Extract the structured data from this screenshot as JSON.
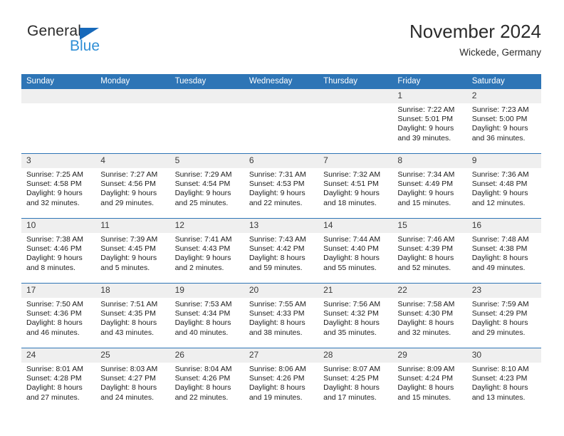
{
  "brand": {
    "name_part1": "General",
    "name_part2": "Blue",
    "triangle_color": "#1769ba",
    "blue_color": "#2f8fd6"
  },
  "header": {
    "month_title": "November 2024",
    "location": "Wickede, Germany"
  },
  "theme": {
    "header_blue": "#2e75b6",
    "daynum_gray": "#efefef",
    "row_divider": "#2e75b6"
  },
  "weekdays": [
    "Sunday",
    "Monday",
    "Tuesday",
    "Wednesday",
    "Thursday",
    "Friday",
    "Saturday"
  ],
  "weeks": [
    [
      {
        "day": "",
        "sunrise": "",
        "sunset": "",
        "daylight1": "",
        "daylight2": ""
      },
      {
        "day": "",
        "sunrise": "",
        "sunset": "",
        "daylight1": "",
        "daylight2": ""
      },
      {
        "day": "",
        "sunrise": "",
        "sunset": "",
        "daylight1": "",
        "daylight2": ""
      },
      {
        "day": "",
        "sunrise": "",
        "sunset": "",
        "daylight1": "",
        "daylight2": ""
      },
      {
        "day": "",
        "sunrise": "",
        "sunset": "",
        "daylight1": "",
        "daylight2": ""
      },
      {
        "day": "1",
        "sunrise": "Sunrise: 7:22 AM",
        "sunset": "Sunset: 5:01 PM",
        "daylight1": "Daylight: 9 hours",
        "daylight2": "and 39 minutes."
      },
      {
        "day": "2",
        "sunrise": "Sunrise: 7:23 AM",
        "sunset": "Sunset: 5:00 PM",
        "daylight1": "Daylight: 9 hours",
        "daylight2": "and 36 minutes."
      }
    ],
    [
      {
        "day": "3",
        "sunrise": "Sunrise: 7:25 AM",
        "sunset": "Sunset: 4:58 PM",
        "daylight1": "Daylight: 9 hours",
        "daylight2": "and 32 minutes."
      },
      {
        "day": "4",
        "sunrise": "Sunrise: 7:27 AM",
        "sunset": "Sunset: 4:56 PM",
        "daylight1": "Daylight: 9 hours",
        "daylight2": "and 29 minutes."
      },
      {
        "day": "5",
        "sunrise": "Sunrise: 7:29 AM",
        "sunset": "Sunset: 4:54 PM",
        "daylight1": "Daylight: 9 hours",
        "daylight2": "and 25 minutes."
      },
      {
        "day": "6",
        "sunrise": "Sunrise: 7:31 AM",
        "sunset": "Sunset: 4:53 PM",
        "daylight1": "Daylight: 9 hours",
        "daylight2": "and 22 minutes."
      },
      {
        "day": "7",
        "sunrise": "Sunrise: 7:32 AM",
        "sunset": "Sunset: 4:51 PM",
        "daylight1": "Daylight: 9 hours",
        "daylight2": "and 18 minutes."
      },
      {
        "day": "8",
        "sunrise": "Sunrise: 7:34 AM",
        "sunset": "Sunset: 4:49 PM",
        "daylight1": "Daylight: 9 hours",
        "daylight2": "and 15 minutes."
      },
      {
        "day": "9",
        "sunrise": "Sunrise: 7:36 AM",
        "sunset": "Sunset: 4:48 PM",
        "daylight1": "Daylight: 9 hours",
        "daylight2": "and 12 minutes."
      }
    ],
    [
      {
        "day": "10",
        "sunrise": "Sunrise: 7:38 AM",
        "sunset": "Sunset: 4:46 PM",
        "daylight1": "Daylight: 9 hours",
        "daylight2": "and 8 minutes."
      },
      {
        "day": "11",
        "sunrise": "Sunrise: 7:39 AM",
        "sunset": "Sunset: 4:45 PM",
        "daylight1": "Daylight: 9 hours",
        "daylight2": "and 5 minutes."
      },
      {
        "day": "12",
        "sunrise": "Sunrise: 7:41 AM",
        "sunset": "Sunset: 4:43 PM",
        "daylight1": "Daylight: 9 hours",
        "daylight2": "and 2 minutes."
      },
      {
        "day": "13",
        "sunrise": "Sunrise: 7:43 AM",
        "sunset": "Sunset: 4:42 PM",
        "daylight1": "Daylight: 8 hours",
        "daylight2": "and 59 minutes."
      },
      {
        "day": "14",
        "sunrise": "Sunrise: 7:44 AM",
        "sunset": "Sunset: 4:40 PM",
        "daylight1": "Daylight: 8 hours",
        "daylight2": "and 55 minutes."
      },
      {
        "day": "15",
        "sunrise": "Sunrise: 7:46 AM",
        "sunset": "Sunset: 4:39 PM",
        "daylight1": "Daylight: 8 hours",
        "daylight2": "and 52 minutes."
      },
      {
        "day": "16",
        "sunrise": "Sunrise: 7:48 AM",
        "sunset": "Sunset: 4:38 PM",
        "daylight1": "Daylight: 8 hours",
        "daylight2": "and 49 minutes."
      }
    ],
    [
      {
        "day": "17",
        "sunrise": "Sunrise: 7:50 AM",
        "sunset": "Sunset: 4:36 PM",
        "daylight1": "Daylight: 8 hours",
        "daylight2": "and 46 minutes."
      },
      {
        "day": "18",
        "sunrise": "Sunrise: 7:51 AM",
        "sunset": "Sunset: 4:35 PM",
        "daylight1": "Daylight: 8 hours",
        "daylight2": "and 43 minutes."
      },
      {
        "day": "19",
        "sunrise": "Sunrise: 7:53 AM",
        "sunset": "Sunset: 4:34 PM",
        "daylight1": "Daylight: 8 hours",
        "daylight2": "and 40 minutes."
      },
      {
        "day": "20",
        "sunrise": "Sunrise: 7:55 AM",
        "sunset": "Sunset: 4:33 PM",
        "daylight1": "Daylight: 8 hours",
        "daylight2": "and 38 minutes."
      },
      {
        "day": "21",
        "sunrise": "Sunrise: 7:56 AM",
        "sunset": "Sunset: 4:32 PM",
        "daylight1": "Daylight: 8 hours",
        "daylight2": "and 35 minutes."
      },
      {
        "day": "22",
        "sunrise": "Sunrise: 7:58 AM",
        "sunset": "Sunset: 4:30 PM",
        "daylight1": "Daylight: 8 hours",
        "daylight2": "and 32 minutes."
      },
      {
        "day": "23",
        "sunrise": "Sunrise: 7:59 AM",
        "sunset": "Sunset: 4:29 PM",
        "daylight1": "Daylight: 8 hours",
        "daylight2": "and 29 minutes."
      }
    ],
    [
      {
        "day": "24",
        "sunrise": "Sunrise: 8:01 AM",
        "sunset": "Sunset: 4:28 PM",
        "daylight1": "Daylight: 8 hours",
        "daylight2": "and 27 minutes."
      },
      {
        "day": "25",
        "sunrise": "Sunrise: 8:03 AM",
        "sunset": "Sunset: 4:27 PM",
        "daylight1": "Daylight: 8 hours",
        "daylight2": "and 24 minutes."
      },
      {
        "day": "26",
        "sunrise": "Sunrise: 8:04 AM",
        "sunset": "Sunset: 4:26 PM",
        "daylight1": "Daylight: 8 hours",
        "daylight2": "and 22 minutes."
      },
      {
        "day": "27",
        "sunrise": "Sunrise: 8:06 AM",
        "sunset": "Sunset: 4:26 PM",
        "daylight1": "Daylight: 8 hours",
        "daylight2": "and 19 minutes."
      },
      {
        "day": "28",
        "sunrise": "Sunrise: 8:07 AM",
        "sunset": "Sunset: 4:25 PM",
        "daylight1": "Daylight: 8 hours",
        "daylight2": "and 17 minutes."
      },
      {
        "day": "29",
        "sunrise": "Sunrise: 8:09 AM",
        "sunset": "Sunset: 4:24 PM",
        "daylight1": "Daylight: 8 hours",
        "daylight2": "and 15 minutes."
      },
      {
        "day": "30",
        "sunrise": "Sunrise: 8:10 AM",
        "sunset": "Sunset: 4:23 PM",
        "daylight1": "Daylight: 8 hours",
        "daylight2": "and 13 minutes."
      }
    ]
  ]
}
